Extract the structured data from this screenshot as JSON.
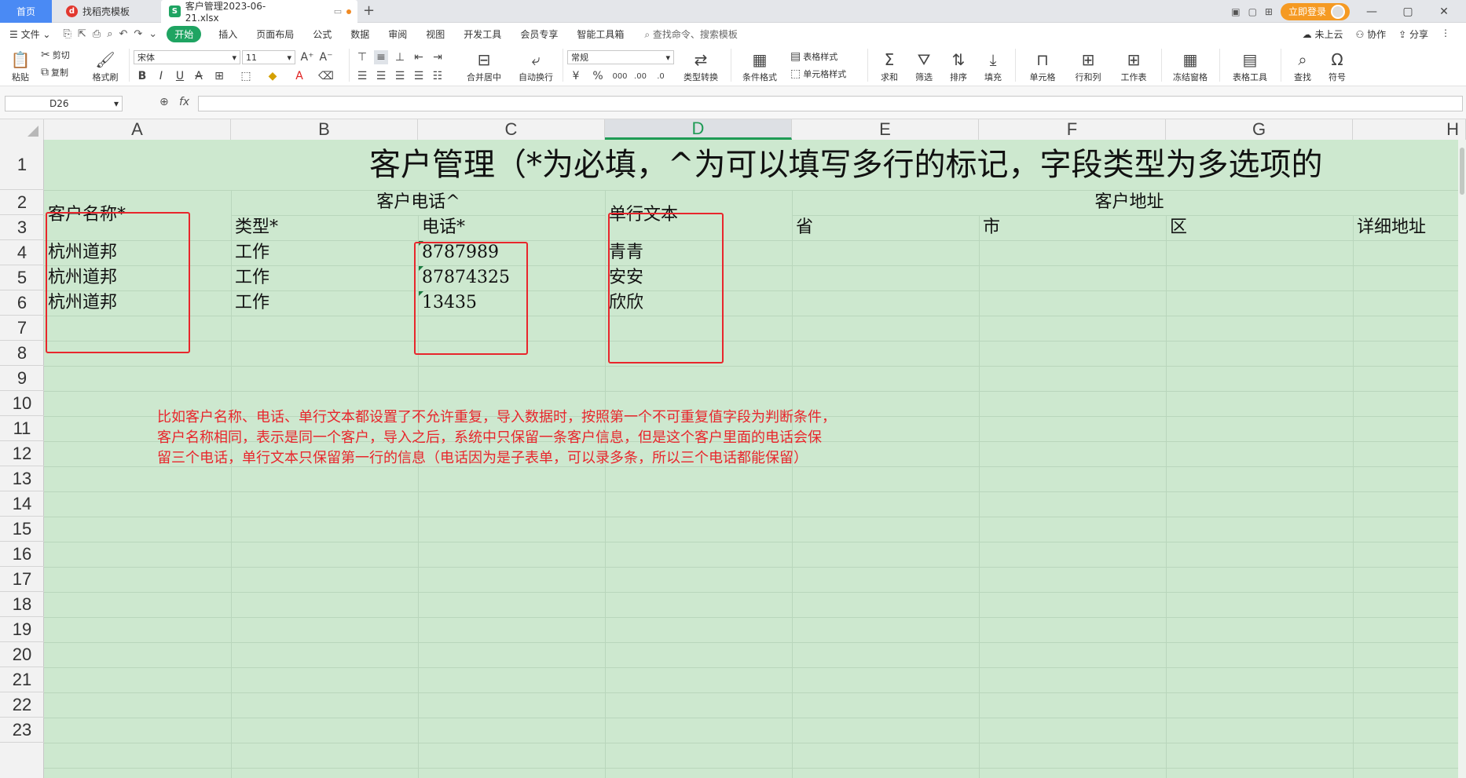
{
  "tabs": {
    "home": "首页",
    "template": "找稻壳模板",
    "file": "客户管理2023-06-21.xlsx",
    "add": "+"
  },
  "top_right": {
    "login": "立即登录"
  },
  "menu": {
    "file": "文件",
    "items": [
      "开始",
      "插入",
      "页面布局",
      "公式",
      "数据",
      "审阅",
      "视图",
      "开发工具",
      "会员专享",
      "智能工具箱"
    ],
    "search": "查找命令、搜索模板",
    "cloud": "未上云",
    "collab": "协作",
    "share": "分享"
  },
  "ribbon": {
    "cut": "剪切",
    "paste": "粘贴",
    "copy": "复制",
    "format_painter": "格式刷",
    "font_name": "宋体",
    "font_size": "11",
    "number_format": "常规",
    "merge_center": "合并居中",
    "wrap": "自动换行",
    "type_convert": "类型转换",
    "cond_format": "条件格式",
    "table_style": "表格样式",
    "cell_style": "单元格样式",
    "sum": "求和",
    "filter": "筛选",
    "sort": "排序",
    "fill": "填充",
    "cell": "单元格",
    "row_col": "行和列",
    "worksheet": "工作表",
    "freeze": "冻结窗格",
    "table_tools": "表格工具",
    "find": "查找",
    "symbol": "符号"
  },
  "formula_bar": {
    "name_box": "D26",
    "fx": "fx",
    "content": ""
  },
  "columns": [
    "A",
    "B",
    "C",
    "D",
    "E",
    "F",
    "G",
    "H"
  ],
  "active_column": "D",
  "rows": [
    "1",
    "2",
    "3",
    "4",
    "5",
    "6",
    "7",
    "8",
    "9",
    "10",
    "11",
    "12",
    "13",
    "14",
    "15",
    "16",
    "17",
    "18",
    "19",
    "20",
    "21",
    "22",
    "23"
  ],
  "sheet": {
    "title": "客户管理（*为必填，^为可以填写多行的标记，字段类型为多选项的",
    "a2": "客户名称*",
    "b2": "客户电话^",
    "d2": "单行文本",
    "e2": "客户地址",
    "b3": "类型*",
    "c3": "电话*",
    "e3": "省",
    "f3": "市",
    "g3": "区",
    "h3": "详细地址",
    "data_rows": [
      {
        "a": "杭州道邦",
        "b": "工作",
        "c": "8787989",
        "d": "青青"
      },
      {
        "a": "杭州道邦",
        "b": "工作",
        "c": "87874325",
        "d": "安安"
      },
      {
        "a": "杭州道邦",
        "b": "工作",
        "c": "13435",
        "d": "欣欣"
      }
    ]
  },
  "note": [
    "比如客户名称、电话、单行文本都设置了不允许重复，导入数据时，按照第一个不可重复值字段为判断条件，",
    "客户名称相同，表示是同一个客户，导入之后，系统中只保留一条客户信息，但是这个客户里面的电话会保",
    "留三个电话，单行文本只保留第一行的信息（电话因为是子表单，可以录多条，所以三个电话都能保留）"
  ],
  "colors": {
    "grid_fill": "#cde8cf",
    "annotation_red": "#e8262c",
    "start_tab_green": "#1fa462",
    "login_orange": "#f59a23"
  }
}
